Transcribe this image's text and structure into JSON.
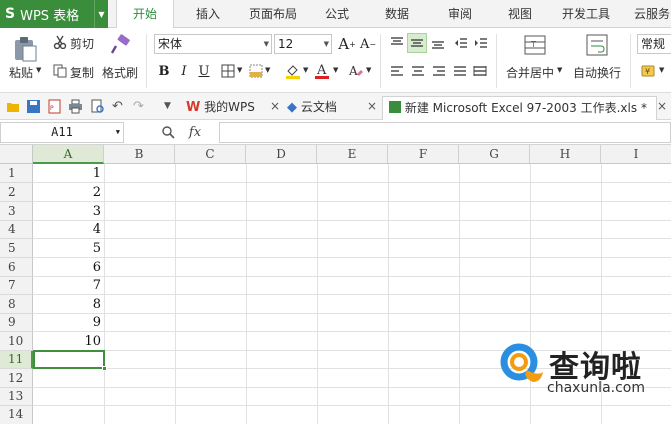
{
  "menubar": {
    "app_logo": "S",
    "app_name": "WPS 表格",
    "tabs": [
      "开始",
      "插入",
      "页面布局",
      "公式",
      "数据",
      "审阅",
      "视图",
      "开发工具",
      "云服务"
    ],
    "active_tab": 0,
    "accent": "#3a8d3a"
  },
  "ribbon": {
    "paste": "粘贴",
    "cut": "剪切",
    "copy": "复制",
    "format_painter": "格式刷",
    "font_name": "宋体",
    "font_size": "12",
    "bold": "B",
    "italic": "I",
    "underline": "U",
    "merge_center": "合并居中",
    "wrap_text": "自动换行",
    "number_format": "常规"
  },
  "docbar": {
    "tabs": [
      {
        "label": "我的WPS",
        "icon": "wps-icon"
      },
      {
        "label": "云文档",
        "icon": "cloud-cube-icon"
      },
      {
        "label": "新建 Microsoft Excel 97-2003 工作表.xls *",
        "icon": "sheet-file-icon"
      }
    ],
    "close_symbol": "×"
  },
  "formula_bar": {
    "cell_ref": "A11",
    "fx": "fx",
    "value": ""
  },
  "sheet": {
    "columns": [
      "A",
      "B",
      "C",
      "D",
      "E",
      "F",
      "G",
      "H",
      "I"
    ],
    "rows": [
      "1",
      "2",
      "3",
      "4",
      "5",
      "6",
      "7",
      "8",
      "9",
      "10",
      "11",
      "12",
      "13",
      "14"
    ],
    "column_a_values": [
      "1",
      "2",
      "3",
      "4",
      "5",
      "6",
      "7",
      "8",
      "9",
      "10"
    ],
    "selected_cell": "A11"
  },
  "watermark": {
    "name": "查询啦",
    "url": "chaxunla.com"
  }
}
